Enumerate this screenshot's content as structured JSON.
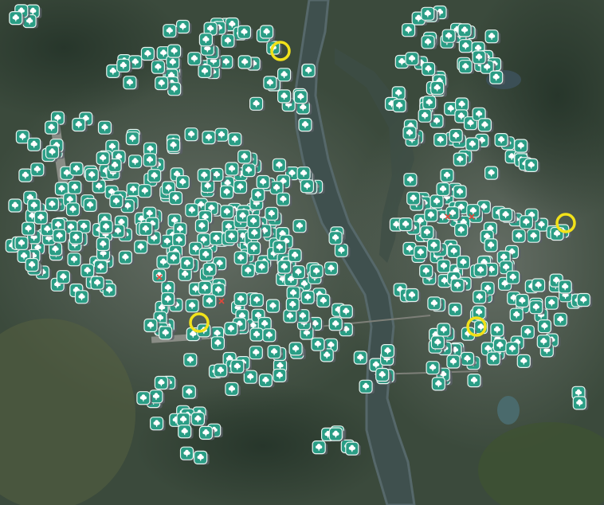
{
  "map": {
    "type": "satellite-map",
    "marker_icon": "tree-icon",
    "colors": {
      "land_dark": "#344236",
      "land_mid": "#4a5a48",
      "urban": "#5d6660",
      "forest": "#2b3b2c",
      "river": "#3c4d4c",
      "river_light": "#56686a",
      "marker_fill": "#2a9d85",
      "marker_border": "#e8f3ef",
      "marker_shadow": "#5a5f66",
      "highlight_ring": "#f2e21a",
      "error_mark": "#e0483c"
    }
  }
}
